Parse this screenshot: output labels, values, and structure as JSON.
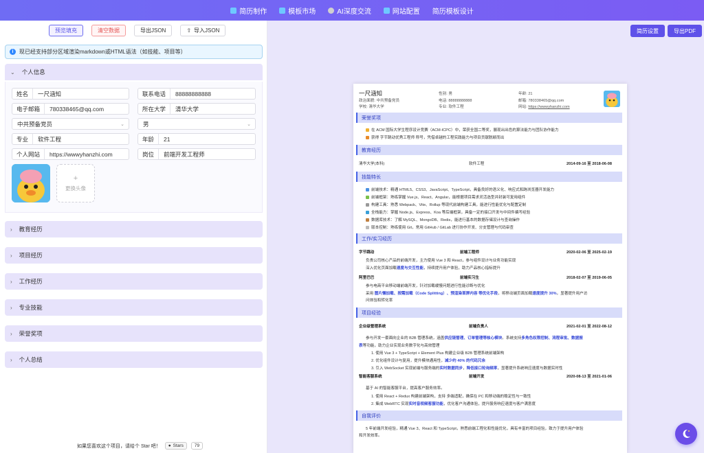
{
  "nav": [
    {
      "label": "简历制作",
      "color": "#6ec8ff"
    },
    {
      "label": "模板市场",
      "color": "#6ec8ff"
    },
    {
      "label": "AI深度交流",
      "color": "#d0d0d0"
    },
    {
      "label": "网站配置",
      "color": "#6ec8ff"
    },
    {
      "label": "简历模板设计",
      "color": ""
    }
  ],
  "toolbar": {
    "fill": "预览填充",
    "clear": "清空数据",
    "export": "导出JSON",
    "import": "导入JSON"
  },
  "notice": "现已经支持部分区域渲染markdown或HTML语法（如技能、项目等）",
  "sections": {
    "personal": "个人信息",
    "education": "教育经历",
    "project": "项目经历",
    "work": "工作经历",
    "skills": "专业技能",
    "honors": "荣誉奖项",
    "summary": "个人总结"
  },
  "form": {
    "name": {
      "label": "姓名",
      "value": "一尺涵知"
    },
    "phone": {
      "label": "联系电话",
      "value": "88888888888"
    },
    "email": {
      "label": "电子邮箱",
      "value": "780338465@qq.com"
    },
    "school": {
      "label": "所在大学",
      "value": "清华大学"
    },
    "party": {
      "value": "中共预备党员"
    },
    "gender": {
      "value": "男"
    },
    "major": {
      "label": "专业",
      "value": "软件工程"
    },
    "age": {
      "label": "年龄",
      "value": "21"
    },
    "site": {
      "label": "个人网站",
      "value": "https://wwwyhanzhi.com"
    },
    "post": {
      "label": "岗位",
      "value": "前端开发工程师"
    },
    "change_avatar": "更换头像"
  },
  "footer": {
    "text": "如果您喜欢这个项目，请给个 Star 吧！",
    "star": "Stars",
    "count": "79"
  },
  "right_buttons": {
    "settings": "简历设置",
    "export_pdf": "导出PDF"
  },
  "resume": {
    "name": "一尺涵知",
    "head": [
      {
        "k": "政治面貌:",
        "v": "中共预备党员"
      },
      {
        "k": "学校:",
        "v": "清华大学"
      },
      {
        "k": "性别:",
        "v": "男"
      },
      {
        "k": "电话:",
        "v": "88888888888"
      },
      {
        "k": "专业:",
        "v": "软件工程"
      },
      {
        "k": "年龄:",
        "v": "21"
      },
      {
        "k": "邮箱:",
        "v": "780338465@qq.com"
      },
      {
        "k": "网站:",
        "v": "https://wwwyhanzhi.com"
      }
    ],
    "sec_honor": "荣誉奖项",
    "honor1": "在 ACM 国际大学生程序设计竞赛（ACM-ICPC）中，荣获全国二等奖，展现出出色的算法能力与团队协作能力",
    "honor2": "获得 字节跳动优秀工程师 称号，凭借卓越的工程实践能力与项目贡献脱颖而出",
    "sec_edu": "教育经历",
    "edu_school": "清华大学(本科)",
    "edu_major": "软件工程",
    "edu_date": "2014-09-16 至 2018-06-08",
    "sec_skill": "技能特长",
    "skills": [
      "前端技术：精通 HTML5、CSS3、JavaScript、TypeScript，具备良好的语义化、响应式和跨浏览器开发能力",
      "前端框架：熟练掌握 Vue.js、React、Angular，能根据项目需求灵活选型并封装可复用组件",
      "构建工具：熟悉 Webpack、Vite、Rollup 等现代前端构建工具，能进行性能优化与配置定制",
      "全栈能力：掌握 Node.js、Express、Koa 等后端框架，具备一定的接口开发与中间件编写经验",
      "数据库技术：了解 MySQL、MongoDB、Redis，能进行基本的数据存储设计与查询操作",
      "版本控制：熟练使用 Git，常用 GitHub / GitLab 进行协作开发、分支管理与代码审查"
    ],
    "sec_work": "工作/实习经历",
    "w1_company": "字节跳动",
    "w1_role": "前端工程师",
    "w1_date": "2020-02-06 至 2025-02-19",
    "w1_l1": "负责公司核心产品的前端开发，主力使用 Vue 3 和 React，参与组件设计与业务功能实现",
    "w1_l2a": "深入优化页面加载",
    "w1_l2b": "速度与交互性能",
    "w1_l2c": "，持续提升用户体验，助力产品核心指标提升",
    "w2_company": "阿里巴巴",
    "w2_role": "前端实习生",
    "w2_date": "2018-02-07 至 2019-06-05",
    "w2_l1": "参与电商平台移动端前端开发，针对加载缓慢问题进行性能诊断与优化",
    "w2_l2a": "采用 ",
    "w2_l2b": "图片懒加载、按需加载（Code Splitting）、预渲染首屏内容 等优化手段",
    "w2_l2c": "，将移动端页面加载",
    "w2_l2d": "速度提升 30%",
    "w2_l2e": "，显著提升用户访",
    "w2_l3": "问体验和转化率",
    "sec_proj": "项目经验",
    "p1_name": "企业级管理系统",
    "p1_role": "前端负责人",
    "p1_date": "2021-02-01 至 2022-08-12",
    "p1_l1a": "参与开发一套面向企业的 B2B 管理系统，涵盖",
    "p1_l1b": "供应链管理、订单管理等核心模块",
    "p1_l1c": "。系统支持",
    "p1_l1d": "多角色权限控制、流程审批、数据报",
    "p1_l2a": "表",
    "p1_l2b": "等功能，助力企业实现业务数字化与高效管理",
    "p1_i1": "1. 使用 Vue 3 + TypeScript + Element Plus 构建企业级 B2B 管理系统前端架构",
    "p1_i2a": "2. 优化组件设计与复用，提升模块通用性，",
    "p1_i2b": "减少约 40% 的代码冗余",
    "p1_i3a": "3. 引入 WebSocket 实现前端与服务端的",
    "p1_i3b": "实时数据同步",
    "p1_i3c": "，",
    "p1_i3d": "降低接口轮询频率",
    "p1_i3e": "，显著提升系统响应速度与数据实时性",
    "p2_name": "智能客服系统",
    "p2_role": "前端开发",
    "p2_date": "2020-08-13 至 2021-01-06",
    "p2_l1": "基于 AI 的智能客服平台，提高客户服务效率。",
    "p2_i1": "1. 使用 React + Redux 构建前端架构，支持 多端适配，确保在 PC 和移动端的稳定性与一致性",
    "p2_i2a": "2. 集成 WebRTC 实现",
    "p2_i2b": "实时音视频客服功能",
    "p2_i2c": "，优化客户沟通体验，提升服务响应速度与客户满意度",
    "sec_self": "自我评价",
    "self_l1": "5 年前端开发经验，精通 Vue 3、React 和 TypeScript，熟悉前端工程化和性能优化，具有丰富的项目经验，致力于提升用户体验",
    "self_l2": "和开发效率。"
  }
}
